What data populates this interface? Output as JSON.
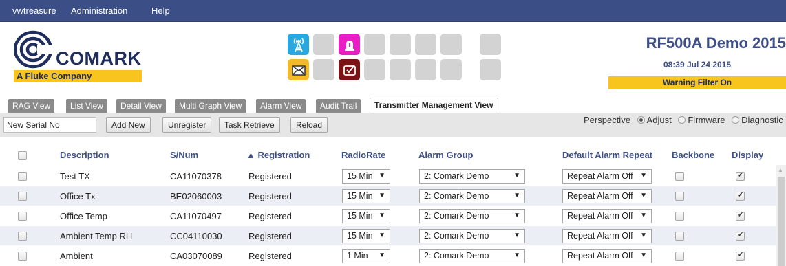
{
  "menu": [
    "vwtreasure",
    "Administration",
    "Help"
  ],
  "logo": {
    "name": "COMARK",
    "subtitle": "A Fluke Company"
  },
  "site": {
    "title": "RF500A Demo 2015",
    "time": "08:39 Jul 24 2015",
    "warning": "Warning Filter On"
  },
  "status_icons": {
    "top": [
      "radio-tower-icon",
      "blank",
      "alarm-beacon-icon",
      "blank",
      "blank",
      "blank",
      "blank",
      "blank"
    ],
    "bottom": [
      "envelope-icon",
      "blank",
      "task-check-icon",
      "blank",
      "blank",
      "blank",
      "blank",
      "blank"
    ],
    "colors": {
      "tower": "#29a8e0",
      "alarm": "#e91ec4",
      "envelope": "#f2b92b",
      "task": "#7a1216",
      "blank": "#d3d3d3"
    }
  },
  "tabs": [
    "RAG View",
    "List View",
    "Detail View",
    "Multi Graph View",
    "Alarm View",
    "Audit Trail",
    "Transmitter Management View"
  ],
  "active_tab": "Transmitter Management View",
  "toolbar": {
    "serial_value": "New Serial No",
    "buttons": [
      "Add New",
      "Unregister",
      "Task Retrieve",
      "Reload"
    ],
    "perspective_label": "Perspective",
    "perspective_options": [
      "Adjust",
      "Firmware",
      "Diagnostic"
    ],
    "perspective_selected": "Adjust"
  },
  "columns": [
    "Description",
    "S/Num",
    "▲ Registration",
    "RadioRate",
    "Alarm Group",
    "Default Alarm Repeat",
    "Backbone",
    "Display"
  ],
  "rows": [
    {
      "description": "Test TX",
      "snum": "CA11070378",
      "registration": "Registered",
      "radiorate": "15 Min",
      "alarm_group": "2: Comark Demo",
      "repeat": "Repeat Alarm Off",
      "backbone": false,
      "display": true
    },
    {
      "description": "Office Tx",
      "snum": "BE02060003",
      "registration": "Registered",
      "radiorate": "15 Min",
      "alarm_group": "2: Comark Demo",
      "repeat": "Repeat Alarm Off",
      "backbone": false,
      "display": true
    },
    {
      "description": "Office Temp",
      "snum": "CA11070497",
      "registration": "Registered",
      "radiorate": "15 Min",
      "alarm_group": "2: Comark Demo",
      "repeat": "Repeat Alarm Off",
      "backbone": false,
      "display": true
    },
    {
      "description": "Ambient Temp RH",
      "snum": "CC04110030",
      "registration": "Registered",
      "radiorate": "15 Min",
      "alarm_group": "2: Comark Demo",
      "repeat": "Repeat Alarm Off",
      "backbone": false,
      "display": true
    },
    {
      "description": "Ambient",
      "snum": "CA03070089",
      "registration": "Registered",
      "radiorate": "1 Min",
      "alarm_group": "2: Comark Demo",
      "repeat": "Repeat Alarm Off",
      "backbone": false,
      "display": true
    }
  ],
  "colors": {
    "menubar": "#3b4f86",
    "accent": "#3d4f86",
    "warning": "#f7c51e",
    "tab": "#8a8a8a",
    "row_alt": "#eceef5"
  }
}
